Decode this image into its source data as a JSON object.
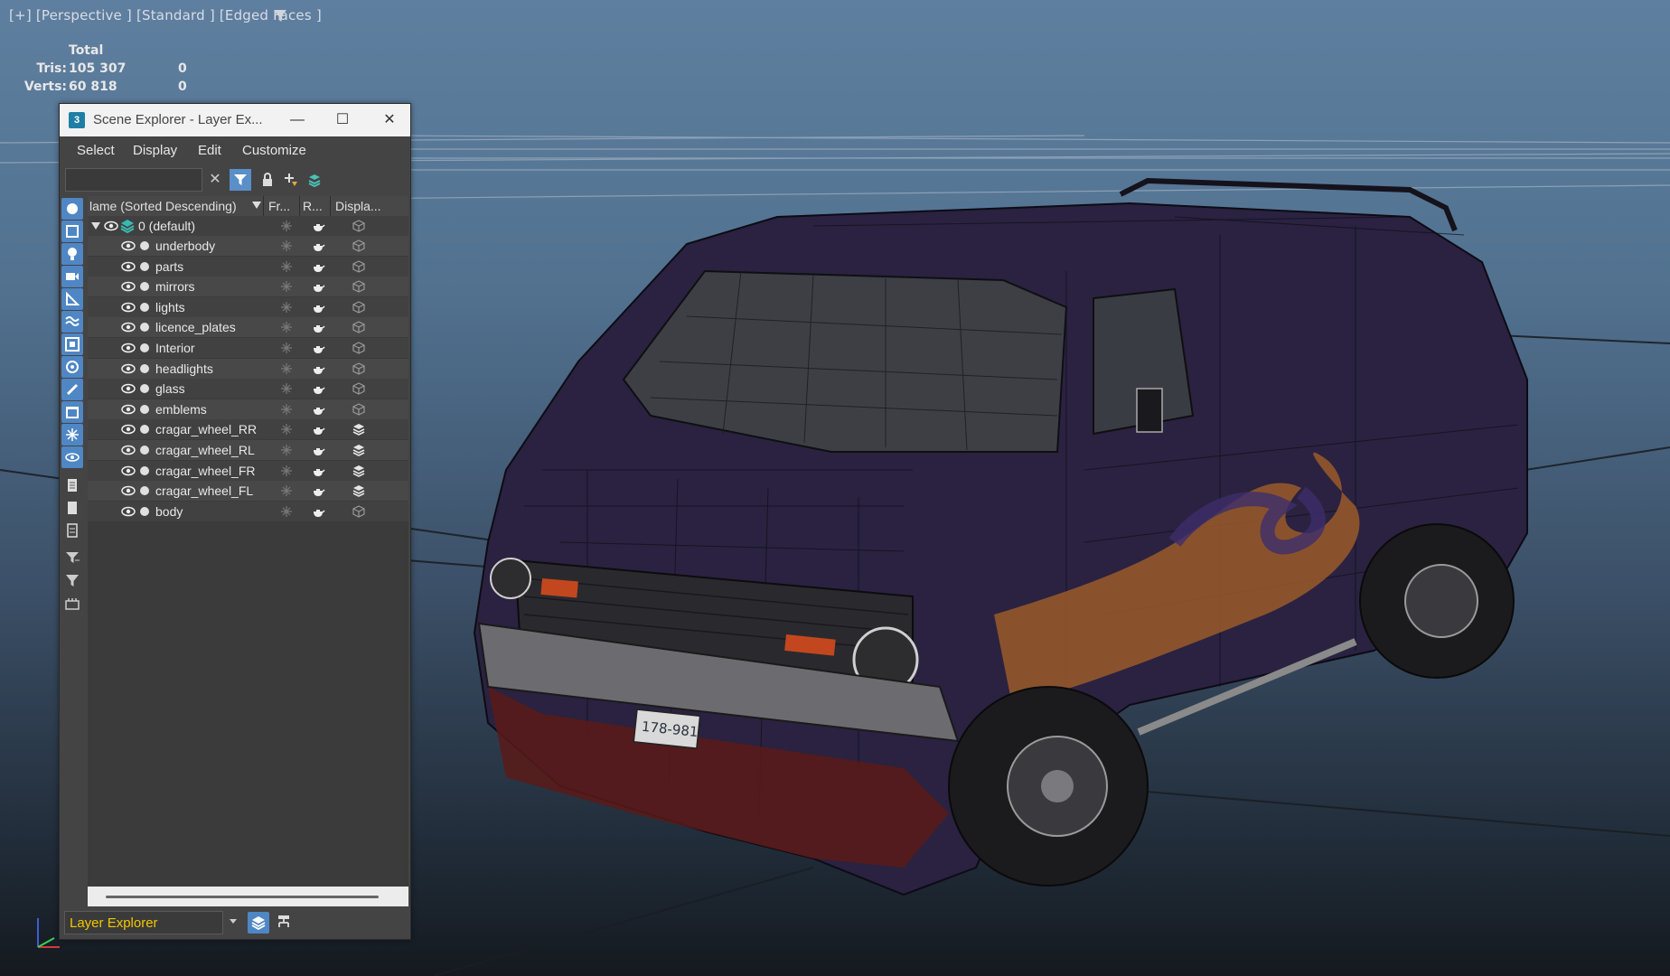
{
  "viewport": {
    "label": "[+] [Perspective ] [Standard ] [Edged Faces ]",
    "stats": {
      "header": "Total",
      "rows": [
        {
          "label": "Tris:",
          "value": "105 307",
          "selected": "0"
        },
        {
          "label": "Verts:",
          "value": "60 818",
          "selected": "0"
        }
      ]
    },
    "license_plate": "178-981"
  },
  "window": {
    "title": "Scene Explorer - Layer Ex...",
    "app_icon": "3",
    "buttons": {
      "minimize": "—",
      "maximize": "☐",
      "close": "✕"
    },
    "menu": [
      "Select",
      "Display",
      "Edit",
      "Customize"
    ],
    "columns": {
      "name": "lame (Sorted Descending)",
      "frozen": "Fr...",
      "render": "R...",
      "display": "Displa..."
    },
    "root_layer": "0 (default)",
    "layers": [
      {
        "name": "underbody",
        "display_icon": "cube-icon"
      },
      {
        "name": "parts",
        "display_icon": "cube-icon"
      },
      {
        "name": "mirrors",
        "display_icon": "cube-icon"
      },
      {
        "name": "lights",
        "display_icon": "cube-icon"
      },
      {
        "name": "licence_plates",
        "display_icon": "cube-icon"
      },
      {
        "name": "Interior",
        "display_icon": "cube-icon"
      },
      {
        "name": "headlights",
        "display_icon": "cube-icon"
      },
      {
        "name": "glass",
        "display_icon": "cube-icon"
      },
      {
        "name": "emblems",
        "display_icon": "cube-icon"
      },
      {
        "name": "cragar_wheel_RR",
        "display_icon": "layers-icon"
      },
      {
        "name": "cragar_wheel_RL",
        "display_icon": "layers-icon"
      },
      {
        "name": "cragar_wheel_FR",
        "display_icon": "layers-icon"
      },
      {
        "name": "cragar_wheel_FL",
        "display_icon": "layers-icon"
      },
      {
        "name": "body",
        "display_icon": "cube-icon"
      }
    ],
    "explorer_select": "Layer Explorer"
  },
  "colors": {
    "accent": "#4f86c4",
    "combo_text": "#f0c800",
    "van_body": "#2a2240"
  }
}
